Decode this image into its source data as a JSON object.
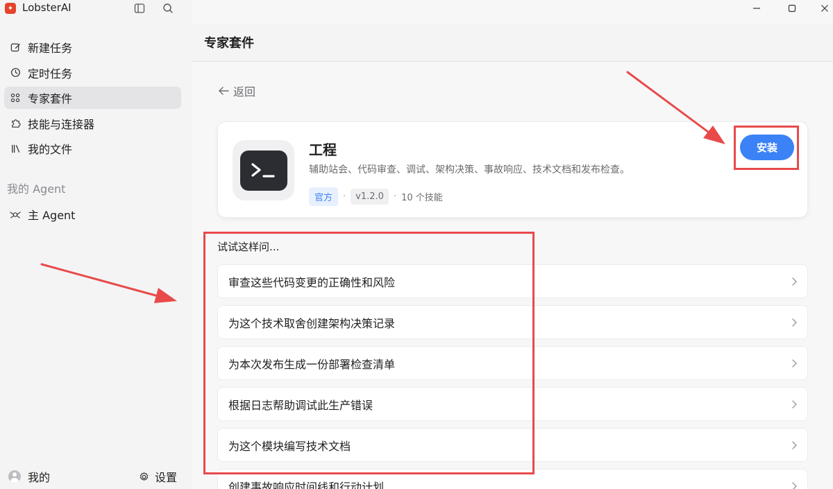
{
  "app": {
    "title": "LobsterAI"
  },
  "sidebar": {
    "items": [
      {
        "label": "新建任务",
        "icon": "edit-icon"
      },
      {
        "label": "定时任务",
        "icon": "clock-icon"
      },
      {
        "label": "专家套件",
        "icon": "grid-icon",
        "active": true
      },
      {
        "label": "技能与连接器",
        "icon": "puzzle-icon"
      },
      {
        "label": "我的文件",
        "icon": "books-icon"
      }
    ],
    "agents_section_title": "我的 Agent",
    "agents": [
      {
        "label": "主 Agent",
        "icon": "agent-icon"
      }
    ],
    "footer": {
      "me_label": "我的",
      "settings_label": "设置"
    }
  },
  "main": {
    "header_title": "专家套件",
    "back_label": "返回",
    "kit": {
      "title": "工程",
      "description": "辅助站会、代码审查、调试、架构决策、事故响应、技术文档和发布检查。",
      "badge_official": "官方",
      "version": "v1.2.0",
      "skills_count": "10 个技能",
      "install_label": "安装"
    },
    "try_label": "试试这样问...",
    "prompts": [
      "审查这些代码变更的正确性和风险",
      "为这个技术取舍创建架构决策记录",
      "为本次发布生成一份部署检查清单",
      "根据日志帮助调试此生产错误",
      "为这个模块编写技术文档",
      "创建事故响应时间线和行动计划"
    ]
  },
  "colors": {
    "accent": "#3b82f6",
    "annotation_red": "#e84a4a",
    "sidebar_bg": "#f4f4f5",
    "card_bg": "#ffffff"
  }
}
